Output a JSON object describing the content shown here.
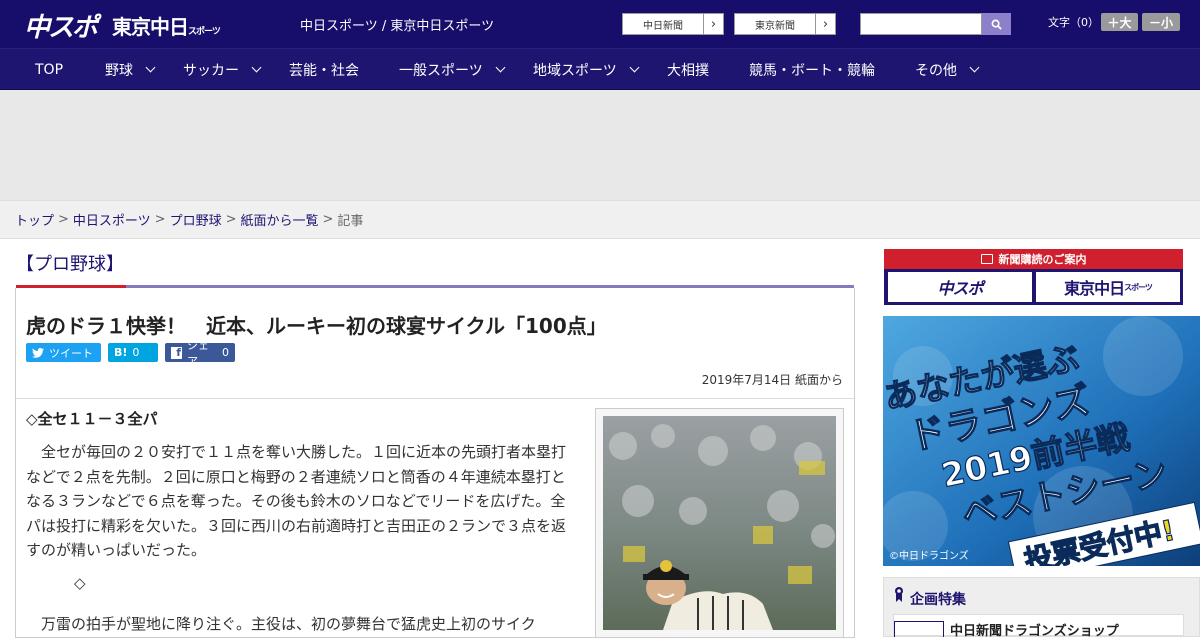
{
  "header": {
    "logo_main": "中スポ",
    "logo_tokyo": "東京中日",
    "logo_tokyo_small": "スポーツ",
    "site_link_1": "中日スポーツ",
    "site_link_sep": " / ",
    "site_link_2": "東京中日スポーツ",
    "paper_btn_1": "中日新聞",
    "paper_btn_2": "東京新聞",
    "search_placeholder": "",
    "font_size_label": "文字（0）",
    "font_bigger": "＋大",
    "font_smaller": "－小"
  },
  "nav": {
    "items": [
      {
        "label": "TOP"
      },
      {
        "label": "野球"
      },
      {
        "label": "サッカー"
      },
      {
        "label": "芸能・社会"
      },
      {
        "label": "一般スポーツ"
      },
      {
        "label": "地域スポーツ"
      },
      {
        "label": "大相撲"
      },
      {
        "label": "競馬・ボート・競輪"
      },
      {
        "label": "その他"
      }
    ]
  },
  "breadcrumb": {
    "items": [
      "トップ",
      "中日スポーツ",
      "プロ野球",
      "紙面から一覧"
    ],
    "current": "記事",
    "separator": ">"
  },
  "article": {
    "category": "【プロ野球】",
    "headline": "虎のドラ１快挙！　近本、ルーキー初の球宴サイクル「100点」",
    "tweet_label": "ツイート",
    "hatena_label": "B!",
    "hatena_count": "0",
    "fb_label": "シェア",
    "fb_count": "0",
    "date": "2019年7月14日 紙面から",
    "score_line": "◇全セ１１－３全パ",
    "paragraph_1": "全セが毎回の２０安打で１１点を奪い大勝した。１回に近本の先頭打者本塁打などで２点を先制。２回に原口と梅野の２者連続ソロと筒香の４年連続本塁打となる３ランなどで６点を奪った。その後も鈴木のソロなどでリードを広げた。全パは投打に精彩を欠いた。３回に西川の右前適時打と吉田正の２ランで３点を返すのが精いっぱいだった。",
    "separator_mark": "◇",
    "paragraph_2": "万雷の拍手が聖地に降り注ぐ。主役は、初の夢舞台で猛虎史上初のサイク"
  },
  "sidebar": {
    "subscribe_title": "新聞購読のご案内",
    "sub_btn_1": "中スポ",
    "sub_btn_2": "東京中日",
    "sub_btn_2_small": "スポーツ",
    "banner_line_1": "あなたが選ぶ",
    "banner_line_2": "ドラゴンズ",
    "banner_line_3": "2019前半戦",
    "banner_line_4": "ベストシーン",
    "banner_cta": "投票受付中!",
    "banner_credit": "©中日ドラゴンズ",
    "feature_title": "企画特集",
    "feature_item_1": "中日新聞ドラゴンズショップ"
  },
  "colors": {
    "brand_navy": "#170e6b",
    "nav_bg": "#1e1570",
    "accent_red": "#d0202e",
    "twitter": "#1da1f2",
    "hatena": "#00a4de",
    "facebook": "#3b5998"
  }
}
